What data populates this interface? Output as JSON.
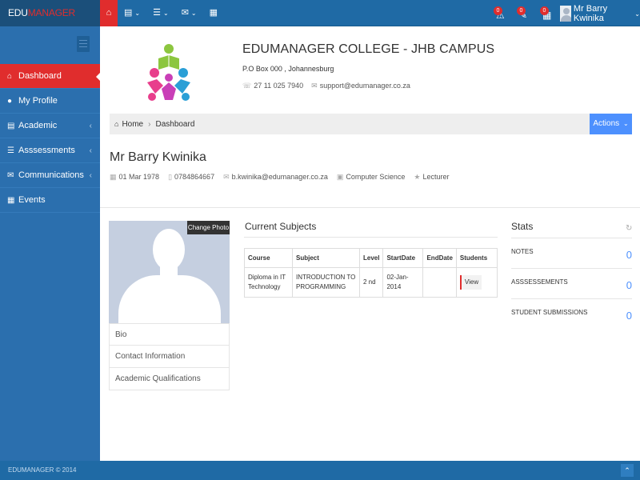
{
  "brand": {
    "part1": "EDU",
    "part2": "MANAGER"
  },
  "topnav": {
    "items": [
      {
        "icon": "home-icon"
      },
      {
        "icon": "book-icon"
      },
      {
        "icon": "list-icon"
      },
      {
        "icon": "envelope-icon"
      },
      {
        "icon": "calendar-icon"
      }
    ]
  },
  "notifications": [
    {
      "icon": "bell-icon",
      "count": "0"
    },
    {
      "icon": "edit-icon",
      "count": "0"
    },
    {
      "icon": "calendar-icon",
      "count": "0"
    }
  ],
  "user": {
    "name": "Mr Barry Kwinika"
  },
  "sidebar": {
    "items": [
      {
        "label": "Dashboard",
        "icon": "home-icon",
        "active": true
      },
      {
        "label": "My Profile",
        "icon": "user-icon"
      },
      {
        "label": "Academic",
        "icon": "book-icon",
        "arrow": "‹"
      },
      {
        "label": "Asssessments",
        "icon": "list-icon",
        "arrow": "‹"
      },
      {
        "label": "Communications",
        "icon": "envelope-icon",
        "arrow": "‹"
      },
      {
        "label": "Events",
        "icon": "calendar-icon"
      }
    ]
  },
  "college": {
    "name": "EDUMANAGER COLLEGE - JHB CAMPUS",
    "address": "P.O Box 000 , Johannesburg",
    "phone": "27 11 025 7940",
    "email": "support@edumanager.co.za"
  },
  "breadcrumb": {
    "home": "Home",
    "current": "Dashboard"
  },
  "actions_label": "Actions",
  "person": {
    "name": "Mr Barry Kwinika",
    "dob": "01 Mar 1978",
    "phone": "0784864667",
    "email": "b.kwinika@edumanager.co.za",
    "department": "Computer Science",
    "role": "Lecturer"
  },
  "profile": {
    "change_photo": "Change Photo",
    "links": [
      "Bio",
      "Contact Information",
      "Academic Qualifications"
    ]
  },
  "subjects": {
    "title": "Current Subjects",
    "headers": [
      "Course",
      "Subject",
      "Level",
      "StartDate",
      "EndDate",
      "Students"
    ],
    "rows": [
      {
        "course_l1": "Diploma in IT",
        "course_l2": "Technology",
        "subject_l1": "INTRODUCTION TO",
        "subject_l2": "PROGRAMMING",
        "level": "2 nd",
        "start": "02-Jan-2014",
        "end": "",
        "students_btn": "View"
      }
    ]
  },
  "stats": {
    "title": "Stats",
    "items": [
      {
        "label": "NOTES",
        "value": "0"
      },
      {
        "label": "ASSSESSEMENTS",
        "value": "0"
      },
      {
        "label": "STUDENT SUBMISSIONS",
        "value": "0"
      }
    ]
  },
  "footer": {
    "text": "EDUMANAGER © 2014"
  },
  "colors": {
    "primary": "#1f6aa5",
    "accent_red": "#e02d2d",
    "button_blue": "#4d90fe"
  }
}
